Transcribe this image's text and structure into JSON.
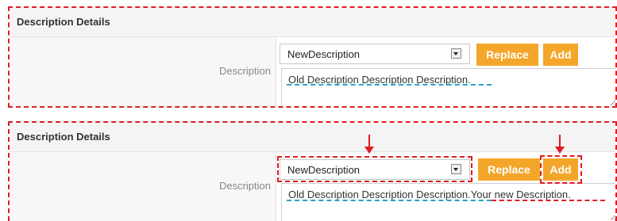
{
  "panels": [
    {
      "title": "Description Details",
      "label": "Description",
      "select_value": "NewDescription",
      "replace_label": "Replace",
      "add_label": "Add",
      "text_old": "Old Description Description Description.",
      "text_new": ""
    },
    {
      "title": "Description Details",
      "label": "Description",
      "select_value": "NewDescription",
      "replace_label": "Replace",
      "add_label": "Add",
      "text_old": "Old Description Description Description.",
      "text_new": "Your new Description."
    }
  ],
  "colors": {
    "accent_button": "#f4a62a",
    "annotation_red": "#e01b24",
    "annotation_blue": "#2aa3c9"
  }
}
